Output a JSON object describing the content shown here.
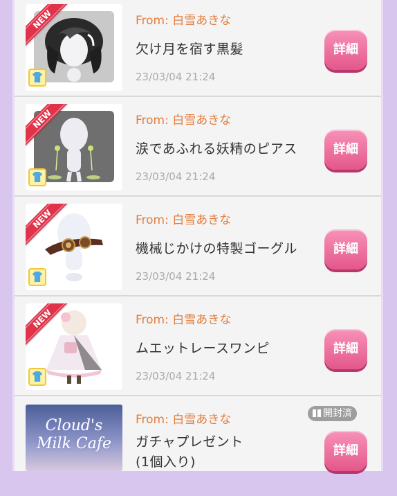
{
  "items": [
    {
      "badge": "NEW",
      "from": "From: 白雪あきな",
      "name": "欠け月を宿す黒髪",
      "date": "23/03/04 21:24",
      "button": "詳細",
      "kind": "hair"
    },
    {
      "badge": "NEW",
      "from": "From: 白雪あきな",
      "name": "涙であふれる妖精のピアス",
      "date": "23/03/04 21:24",
      "button": "詳細",
      "kind": "earrings"
    },
    {
      "badge": "NEW",
      "from": "From: 白雪あきな",
      "name": "機械じかけの特製ゴーグル",
      "date": "23/03/04 21:24",
      "button": "詳細",
      "kind": "goggles"
    },
    {
      "badge": "NEW",
      "from": "From: 白雪あきな",
      "name": "ムエットレースワンピ",
      "date": "23/03/04 21:24",
      "button": "詳細",
      "kind": "dress"
    }
  ],
  "gacha": {
    "banner_line1": "Cloud's",
    "banner_line2": "Milk Cafe",
    "from": "From: 白雪あきな",
    "name_line1": "ガチャプレゼント",
    "name_line2": "(1個入り)",
    "status": "開封済",
    "button": "詳細"
  },
  "colors": {
    "from_text": "#e37c3d",
    "button_pink": "#ec6a99",
    "new_ribbon": "#e0334a",
    "background_lilac": "#d9c6ef"
  }
}
